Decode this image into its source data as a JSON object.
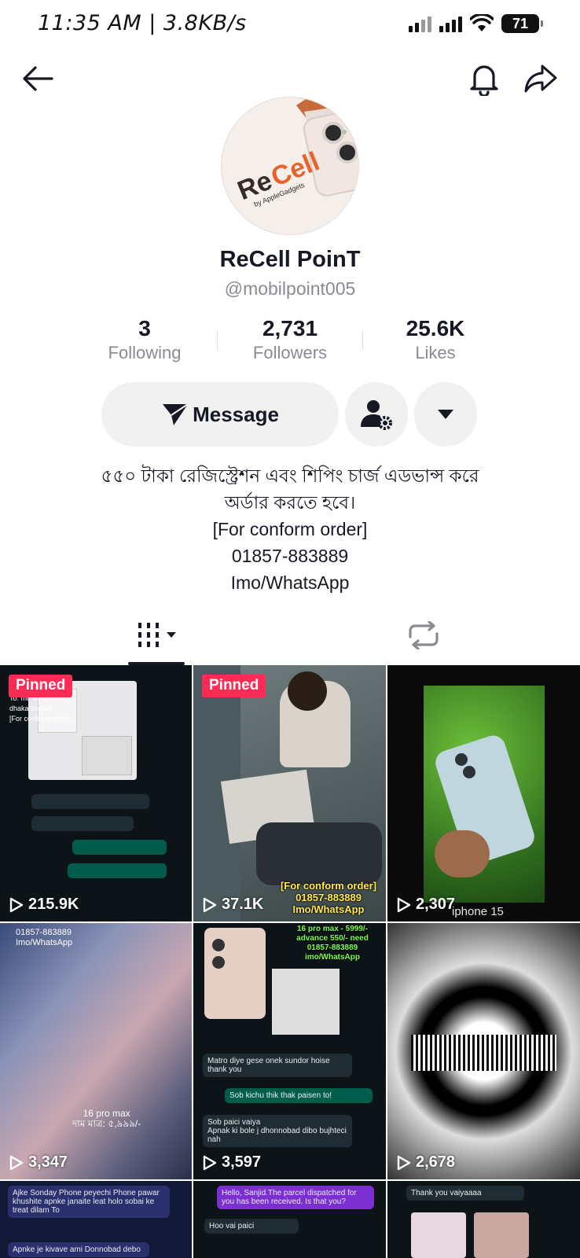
{
  "status_bar": {
    "time": "11:35 AM | 3.8KB/s",
    "battery": "71"
  },
  "profile": {
    "name": "ReCell PoinT",
    "handle": "@mobilpoint005",
    "avatar_brand": "ReCell",
    "avatar_sub": "by AppleGadgets"
  },
  "stats": {
    "following": {
      "value": "3",
      "label": "Following"
    },
    "followers": {
      "value": "2,731",
      "label": "Followers"
    },
    "likes": {
      "value": "25.6K",
      "label": "Likes"
    }
  },
  "actions": {
    "message_label": "Message"
  },
  "bio": {
    "line1": "৫৫০ টাকা রেজিস্ট্রেশন এবং শিপিং চার্জ  এডভান্স করে",
    "line2": "অর্ডার করতে হবে।",
    "line3": "[For conform order]",
    "line4": "01857-883889",
    "line5": "Imo/WhatsApp"
  },
  "videos": [
    {
      "views": "215.9K",
      "pinned": "Pinned"
    },
    {
      "views": "37.1K",
      "pinned": "Pinned",
      "caption": "[For conform order]\n01857-883889\nImo/WhatsApp"
    },
    {
      "views": "2,307",
      "caption": "iphone 15"
    },
    {
      "views": "3,347",
      "caption_top": "01857-883889\nImo/WhatsApp",
      "caption_bottom": "16 pro max\nদাম মাত্র: ৫,৯৯৯/-"
    },
    {
      "views": "3,597",
      "caption": "16 pro max - 5999/-\nadvance 550/- need\n01857-883889\nimo/WhatsApp",
      "chat1": "Matro diye gese onek sundor hoise thank you",
      "chat2": "Sob kichu thik thak paisen to!",
      "chat3": "Sob paici vaiya\nApnak ki bole j dhonnobad dibo bujhteci nah"
    },
    {
      "views": "2,678"
    },
    {
      "chat1": "Ajke Sonday Phone peyechi Phone pawar khushite apnke janaite leat holo sobai ke treat dilam To",
      "chat2": "Apnke je kivave ami Donnobad debo"
    },
    {
      "chat1": "Hello, Sanjid.The parcel dispatched for you has been received. Is that you?",
      "chat2": "Hoo vai paici"
    },
    {
      "chat1": "Thank you vaiyaaaa"
    }
  ],
  "colors": {
    "pinned_badge": "#fe2c55",
    "button_bg": "#f1f1f2",
    "secondary_text": "#8a8b91"
  }
}
